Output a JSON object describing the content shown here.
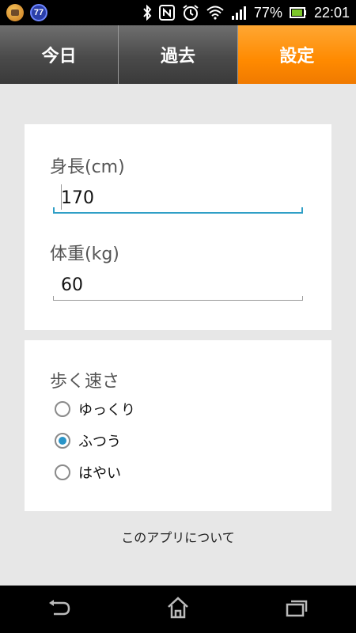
{
  "status_bar": {
    "notification_badge": "77",
    "battery_percent": "77%",
    "time": "22:01",
    "icons": [
      "bluetooth-icon",
      "nfc-icon",
      "alarm-icon",
      "wifi-icon",
      "signal-icon",
      "battery-icon"
    ]
  },
  "tabs": [
    {
      "label": "今日",
      "active": false
    },
    {
      "label": "過去",
      "active": false
    },
    {
      "label": "設定",
      "active": true
    }
  ],
  "body_profile": {
    "height_label": "身長(cm)",
    "height_value": "170",
    "weight_label": "体重(kg)",
    "weight_value": "60"
  },
  "walking_speed": {
    "title": "歩く速さ",
    "options": [
      {
        "label": "ゆっくり",
        "selected": false
      },
      {
        "label": "ふつう",
        "selected": true
      },
      {
        "label": "はやい",
        "selected": false
      }
    ]
  },
  "about_link": "このアプリについて",
  "colors": {
    "accent": "#ff8a00",
    "input_focus": "#2f9fc6",
    "radio_selected": "#2a95c8"
  },
  "nav_bar": [
    "back-icon",
    "home-icon",
    "recent-apps-icon"
  ]
}
